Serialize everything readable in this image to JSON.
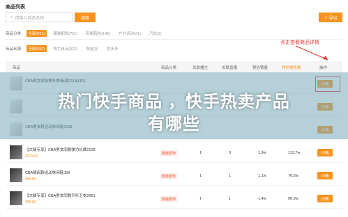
{
  "page": {
    "title": "商品列表"
  },
  "search": {
    "placeholder": "请输入商品名称",
    "button": "搜索"
  },
  "export": {
    "label": "导出"
  },
  "filters": {
    "category": {
      "label": "商品分类:",
      "options": [
        "全部(931)",
        "服装配饰(751)",
        "鞋帽箱包(146)",
        "户外运动(21)",
        "汽车(1)"
      ]
    },
    "source": {
      "label": "商品来源:",
      "options": [
        "全部(931)",
        "快手自有(922)",
        "淘宝(9)",
        "拼多多"
      ]
    }
  },
  "annotation": {
    "text": "点击查看商品详情"
  },
  "table": {
    "headers": [
      "商品",
      "商品分类",
      "关联播主",
      "关联直播",
      "预估销量",
      "预估销售额",
      "操作"
    ],
    "rows": [
      {
        "name": "CBA男女家秋季冬季/新款2118(HG)",
        "price": "",
        "category": "",
        "c1": "",
        "c2": "",
        "c3": "",
        "c4": "",
        "action": "详情",
        "thumb": "light"
      },
      {
        "name": "",
        "price": "",
        "category": "",
        "c1": "",
        "c2": "",
        "c3": "",
        "c4": "",
        "action": "详情",
        "thumb": "light"
      },
      {
        "name": "CBA男女鞋运动休闲鞋2108",
        "price": "",
        "category": "",
        "c1": "",
        "c2": "",
        "c3": "",
        "c4": "",
        "action": "详情",
        "thumb": "light"
      },
      {
        "name": "【大疑专享】CBA男女同款弹力长裤2128",
        "price": "¥279.00",
        "category": "服装配饰",
        "c1": "1",
        "c2": "3",
        "c3": "1.9w",
        "c4": "113.7w",
        "action": "详情",
        "thumb": "dark"
      },
      {
        "name": "CBA情侣款运动休闲鞋J39",
        "price": "¥69.00",
        "category": "服装配饰",
        "c1": "1",
        "c2": "1",
        "c3": "1.1w",
        "c4": "76.5w",
        "action": "详情",
        "thumb": "dark"
      },
      {
        "name": "【大疑专享】CBA男女同款开衫卫衣2661",
        "price": "¥69.00",
        "category": "服装配饰",
        "c1": "1",
        "c2": "1",
        "c3": "1.4w",
        "c4": "96.9w",
        "action": "详情",
        "thumb": "dark"
      }
    ]
  },
  "overlay": {
    "line1": "热门快手商品 ，快手热卖产品",
    "line2": "有哪些"
  }
}
